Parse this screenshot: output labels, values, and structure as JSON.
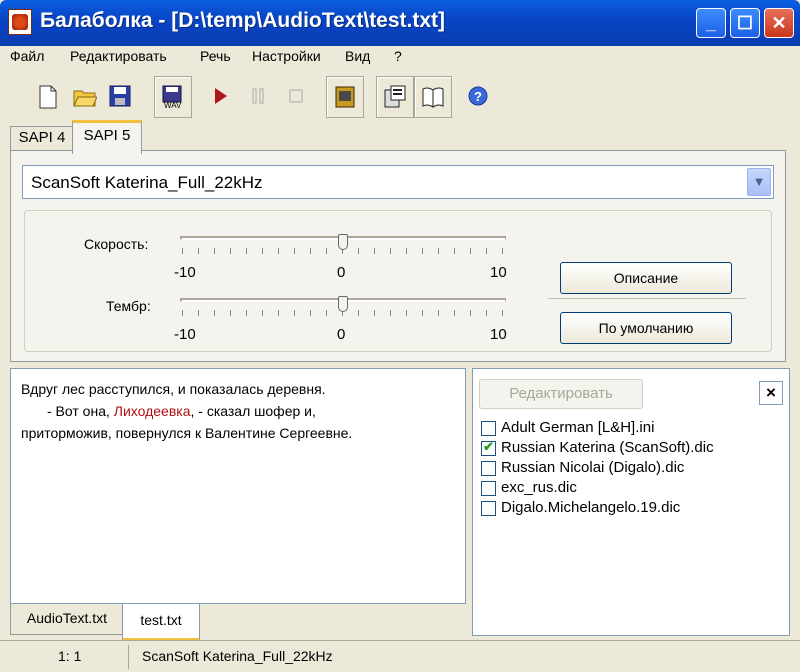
{
  "window": {
    "title": "Балаболка - [D:\\temp\\AudioText\\test.txt]"
  },
  "menu": [
    "Файл",
    "Редактировать",
    "Речь",
    "Настройки",
    "Вид",
    "?"
  ],
  "toolbar": {
    "icons": [
      "new-file-icon",
      "open-folder-icon",
      "save-icon",
      "save-audio-icon",
      "play-icon",
      "pause-icon",
      "stop-icon",
      "voice-book-icon",
      "clipboard-icon",
      "book-icon",
      "help-icon"
    ]
  },
  "engine_tabs": [
    "SAPI 4",
    "SAPI 5"
  ],
  "voice": {
    "selected": "ScanSoft Katerina_Full_22kHz"
  },
  "speed": {
    "label": "Скорость:",
    "min": "-10",
    "mid": "0",
    "max": "10",
    "value": 0
  },
  "pitch": {
    "label": "Тембр:",
    "min": "-10",
    "mid": "0",
    "max": "10",
    "value": 0
  },
  "buttons": {
    "description": "Описание",
    "defaults": "По умолчанию"
  },
  "editor": {
    "line1": "Вдруг лес расступился, и показалась деревня.",
    "line2a": "- Вот она, ",
    "line2b": "Лиходеевка",
    "line2c": ", - сказал шофер и,",
    "line3": "приторможив, повернулся к Валентине Сергеевне."
  },
  "dictionaries": {
    "edit_label": "Редактировать",
    "close": "×",
    "items": [
      {
        "label": "Adult German [L&H].ini",
        "checked": false
      },
      {
        "label": "Russian Katerina (ScanSoft).dic",
        "checked": true
      },
      {
        "label": "Russian Nicolai (Digalo).dic",
        "checked": false
      },
      {
        "label": "exc_rus.dic",
        "checked": false
      },
      {
        "label": "Digalo.Michelangelo.19.dic",
        "checked": false
      }
    ]
  },
  "doc_tabs": [
    "AudioText.txt",
    "test.txt"
  ],
  "status": {
    "position": "1: 1",
    "voice": "ScanSoft Katerina_Full_22kHz"
  },
  "colors": {
    "accent": "#0a5fe0",
    "highlight_text": "#b01010"
  }
}
